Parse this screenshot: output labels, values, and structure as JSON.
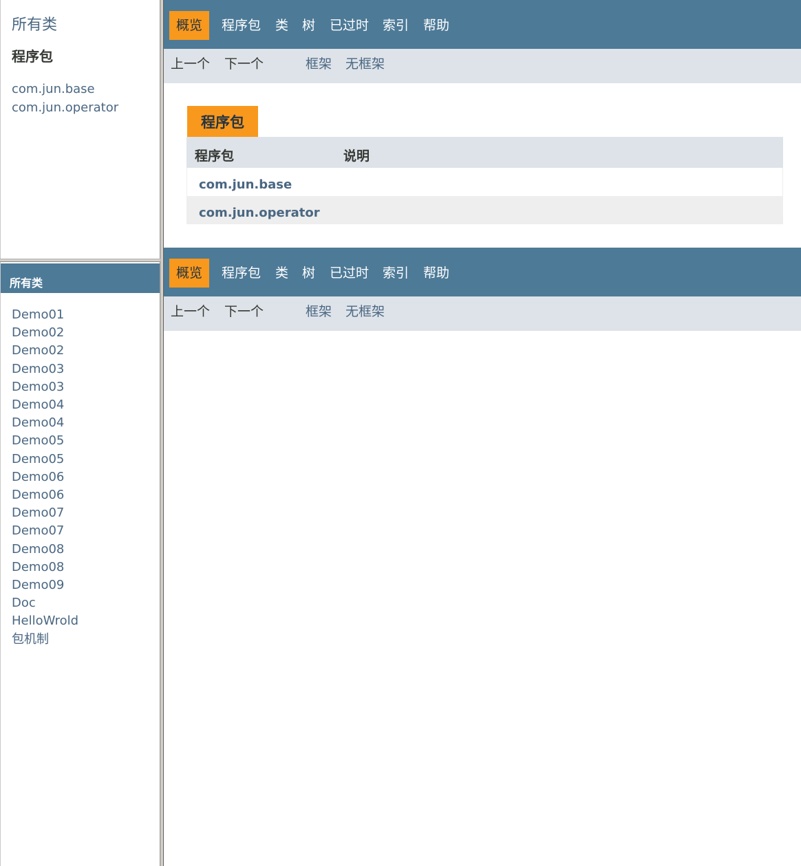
{
  "package_frame": {
    "all_classes_link": "所有类",
    "packages_heading": "程序包",
    "packages": [
      "com.jun.base",
      "com.jun.operator"
    ]
  },
  "class_frame": {
    "title": "所有类",
    "classes": [
      "Demo01",
      "Demo02",
      "Demo02",
      "Demo03",
      "Demo03",
      "Demo04",
      "Demo04",
      "Demo05",
      "Demo05",
      "Demo06",
      "Demo06",
      "Demo07",
      "Demo07",
      "Demo08",
      "Demo08",
      "Demo09",
      "Doc",
      "HelloWrold",
      "包机制"
    ]
  },
  "top_nav": {
    "overview": "概览",
    "package": "程序包",
    "class": "类",
    "tree": "树",
    "deprecated": "已过时",
    "index": "索引",
    "help": "帮助"
  },
  "sub_nav": {
    "prev": "上一个",
    "next": "下一个",
    "frames": "框架",
    "no_frames": "无框架"
  },
  "summary": {
    "caption": "程序包",
    "col_package": "程序包",
    "col_description": "说明",
    "rows": [
      {
        "package": "com.jun.base",
        "description": ""
      },
      {
        "package": "com.jun.operator",
        "description": ""
      }
    ]
  },
  "colors": {
    "nav_bar": "#4d7a97",
    "active_tab": "#f8981d",
    "sub_nav": "#dee3e9",
    "link": "#4a6782"
  }
}
